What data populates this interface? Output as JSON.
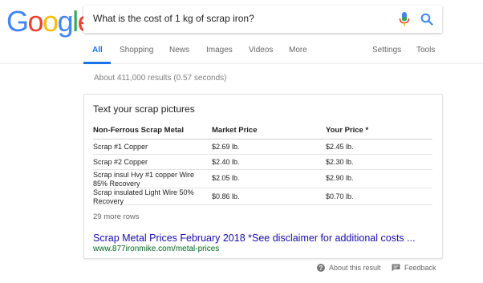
{
  "logo": {
    "letters": [
      "G",
      "o",
      "o",
      "g",
      "l",
      "e"
    ],
    "colors": [
      "#4285F4",
      "#EA4335",
      "#FBBC05",
      "#4285F4",
      "#34A853",
      "#EA4335"
    ]
  },
  "search": {
    "query": "What is the cost of 1 kg of scrap iron?",
    "mic_icon": "mic-icon",
    "search_icon": "search-icon",
    "accent": "#4285F4"
  },
  "tabs": {
    "all": "All",
    "shopping": "Shopping",
    "news": "News",
    "images": "Images",
    "videos": "Videos",
    "more": "More",
    "settings": "Settings",
    "tools": "Tools",
    "active": "All"
  },
  "stats": "About 411,000 results (0.57 seconds)",
  "card": {
    "title": "Text your scrap pictures",
    "headers": [
      "Non-Ferrous Scrap Metal",
      "Market Price",
      "Your Price *"
    ],
    "rows": [
      {
        "name": "Scrap #1 Copper",
        "market": "$2.69 lb.",
        "yours": "$2.45 lb."
      },
      {
        "name": "Scrap #2 Copper",
        "market": "$2.40 lb.",
        "yours": "$2.30 lb."
      },
      {
        "name": "Scrap insul Hvy #1 copper Wire 85% Recovery",
        "market": "$2.05 lb.",
        "yours": "$2.90 lb."
      },
      {
        "name": "Scrap insulated Light Wire 50% Recovery",
        "market": "$0.86 lb.",
        "yours": "$0.70 lb."
      }
    ],
    "more_rows": "29 more rows",
    "link_title": "Scrap Metal Prices February 2018 *See disclaimer for additional costs ...",
    "url": "www.877ironmike.com/metal-prices"
  },
  "footer": {
    "about": "About this result",
    "feedback": "Feedback",
    "about_icon": "help-circle-icon",
    "feedback_icon": "feedback-icon"
  }
}
